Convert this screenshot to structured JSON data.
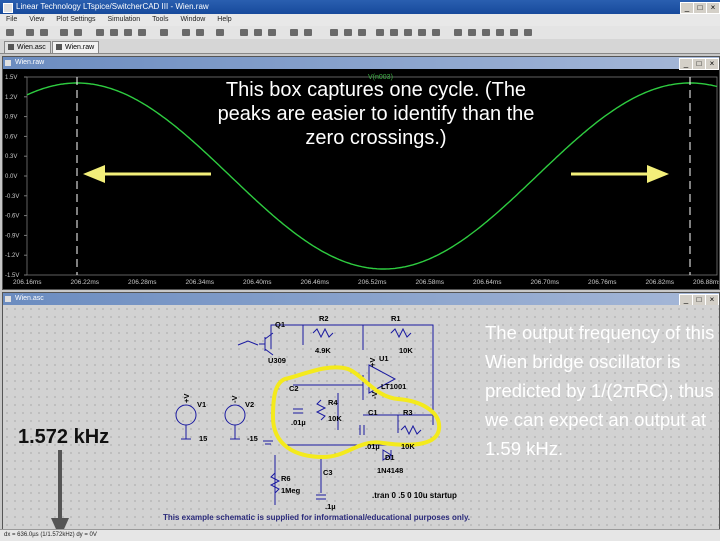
{
  "window": {
    "title": "Linear Technology LTspice/SwitcherCAD III - Wien.raw"
  },
  "menu": [
    "File",
    "View",
    "Plot Settings",
    "Simulation",
    "Tools",
    "Window",
    "Help"
  ],
  "tabs": [
    {
      "label": "Wien.asc"
    },
    {
      "label": "Wien.raw"
    }
  ],
  "waveform": {
    "window_title": "Wien.raw",
    "trace_label": "V(n003)",
    "y_ticks": [
      "1.5V",
      "1.2V",
      "0.9V",
      "0.6V",
      "0.3V",
      "0.0V",
      "-0.3V",
      "-0.6V",
      "-0.9V",
      "-1.2V",
      "-1.5V"
    ],
    "x_ticks": [
      "206.16ms",
      "206.22ms",
      "206.28ms",
      "206.34ms",
      "206.40ms",
      "206.46ms",
      "206.52ms",
      "206.58ms",
      "206.64ms",
      "206.70ms",
      "206.76ms",
      "206.82ms",
      "206.88ms"
    ]
  },
  "annotation": {
    "box_text": "This box captures one cycle. (The peaks are easier to identify than the zero crossings.)",
    "note": "The output frequency of this Wien bridge oscillator is predicted by 1/(2πRC), thus we can expect an output at 1.59 kHz.",
    "freq": "1.572 kHz"
  },
  "schematic": {
    "window_title": "Wien.asc",
    "labels": {
      "q1": "Q1",
      "u309": "U309",
      "r2": "R2",
      "r2v": "4.9K",
      "r1": "R1",
      "r1v": "10K",
      "u1": "U1",
      "lt1001": "LT1001",
      "c2": "C2",
      "c2v": ".01µ",
      "r4": "R4",
      "r4v": "10K",
      "c1": "C1",
      "c1v": ".01µ",
      "r3": "R3",
      "r3v": "10K",
      "d1": "D1",
      "d1v": "1N4148",
      "r6": "R6",
      "r6v": "1Meg",
      "c3": "C3",
      "c3v": ".1µ",
      "v1": "V1",
      "v1v": "15",
      "v2": "V2",
      "v2v": "-15",
      "plusv": "+V",
      "minusv": "-V",
      "pv2": "+V",
      "mv2": "-V"
    },
    "directive": ".tran 0 .5 0 10u startup",
    "disclaimer": "This example schematic is supplied for informational/educational purposes only."
  },
  "statusbar": {
    "text": "dx = 636.0µs (1/1.572kHz)    dy = 0V"
  }
}
